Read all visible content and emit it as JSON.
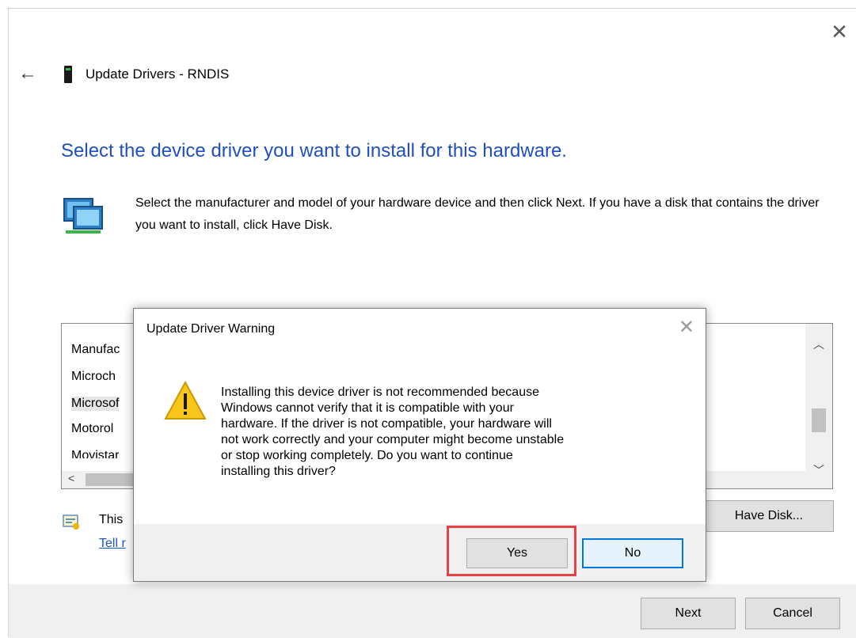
{
  "window": {
    "title": "Update Drivers - RNDIS",
    "heading": "Select the device driver you want to install for this hardware.",
    "intro": "Select the manufacturer and model of your hardware device and then click Next. If you have a disk that contains the driver you want to install, click Have Disk.",
    "list": {
      "header": "Manufac",
      "items": [
        "Microch",
        "Microsof",
        "Motorol",
        "Movistar"
      ],
      "selected_index": 1
    },
    "signed_text": "This",
    "tell_link": "Tell r",
    "have_disk_label": "Have Disk...",
    "next_label": "Next",
    "cancel_label": "Cancel"
  },
  "dialog": {
    "title": "Update Driver Warning",
    "message": "Installing this device driver is not recommended because\nWindows cannot verify that it is compatible with your\nhardware.  If the driver is not compatible, your hardware will\nnot work correctly and your computer might become unstable\nor stop working completely.  Do you want to continue\ninstalling this driver?",
    "yes_label": "Yes",
    "no_label": "No",
    "highlight_color": "#e5434a"
  },
  "icons": {
    "back": "back-arrow-icon",
    "close": "close-icon",
    "device": "device-icon",
    "hardware": "hardware-icon",
    "warning": "warning-icon",
    "signed": "signed-driver-icon"
  },
  "colors": {
    "heading": "#1f4fbf",
    "link": "#1a56c9",
    "default_button_border": "#0078d7"
  }
}
